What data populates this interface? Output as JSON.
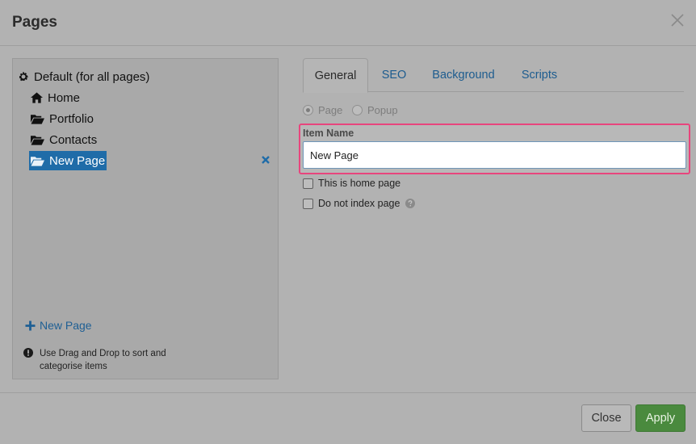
{
  "dialog": {
    "title": "Pages"
  },
  "tree": {
    "root_label": "Default (for all pages)",
    "items": [
      {
        "label": "Home",
        "icon": "home-icon"
      },
      {
        "label": "Portfolio",
        "icon": "folder-open-icon"
      },
      {
        "label": "Contacts",
        "icon": "folder-open-icon"
      },
      {
        "label": "New Page",
        "icon": "folder-open-icon",
        "selected": true
      }
    ],
    "add_label": "New Page",
    "hint": "Use Drag and Drop to sort and categorise items"
  },
  "tabs": [
    {
      "label": "General",
      "active": true
    },
    {
      "label": "SEO",
      "active": false
    },
    {
      "label": "Background",
      "active": false
    },
    {
      "label": "Scripts",
      "active": false
    }
  ],
  "general": {
    "type_options": [
      {
        "label": "Page",
        "checked": true
      },
      {
        "label": "Popup",
        "checked": false
      }
    ],
    "item_name_label": "Item Name",
    "item_name_value": "New Page",
    "home_page_label": "This is home page",
    "no_index_label": "Do not index page"
  },
  "footer": {
    "close_label": "Close",
    "apply_label": "Apply"
  },
  "colors": {
    "accent": "#1f6ca8",
    "apply": "#4a8a3e",
    "highlight": "#e8457d"
  }
}
